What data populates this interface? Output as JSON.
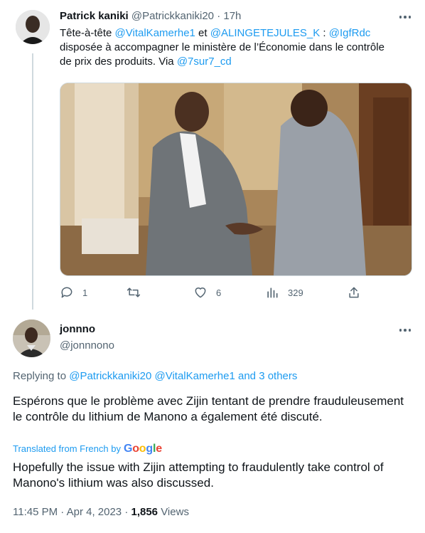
{
  "tweet": {
    "author_name": "Patrick kaniki",
    "author_handle": "@Patrickkaniki20",
    "separator": "·",
    "time": "17h",
    "text_parts": [
      {
        "t": "Tête-à-tête ",
        "link": false
      },
      {
        "t": "@VitalKamerhe1",
        "link": true
      },
      {
        "t": " et ",
        "link": false
      },
      {
        "t": "@ALINGETEJULES_K",
        "link": true
      },
      {
        "t": " : ",
        "link": false
      },
      {
        "t": "@IgfRdc",
        "link": true
      },
      {
        "t": " disposée à accompagner le ministère de l’Économie dans le contrôle de prix des produits. Via ",
        "link": false
      },
      {
        "t": "@7sur7_cd",
        "link": true
      }
    ],
    "actions": {
      "reply_count": "1",
      "retweet_count": "",
      "like_count": "6",
      "views_count": "329"
    }
  },
  "reply": {
    "author_name": "jonnno",
    "author_handle": "@jonnnono",
    "replying_prefix": "Replying to",
    "replying_targets": "@Patrickkaniki20 @VitalKamerhe1 and 3 others",
    "text": "Espérons que le problème avec Zijin tentant de prendre frauduleusement le contrôle du lithium de Manono a également été discuté.",
    "translated_label": "Translated from French by",
    "translator_brand": "Google",
    "translated_text": "Hopefully the issue with Zijin attempting to fraudulently take control of Manono's lithium was also discussed.",
    "timestamp": "11:45 PM · Apr 4, 2023 · ",
    "views_count": "1,856",
    "views_label": " Views"
  },
  "colors": {
    "link": "#1d9bf0",
    "muted": "#536471",
    "text": "#0f1419"
  },
  "icons": [
    "more-icon",
    "reply-icon",
    "retweet-icon",
    "like-icon",
    "views-icon",
    "share-icon"
  ]
}
